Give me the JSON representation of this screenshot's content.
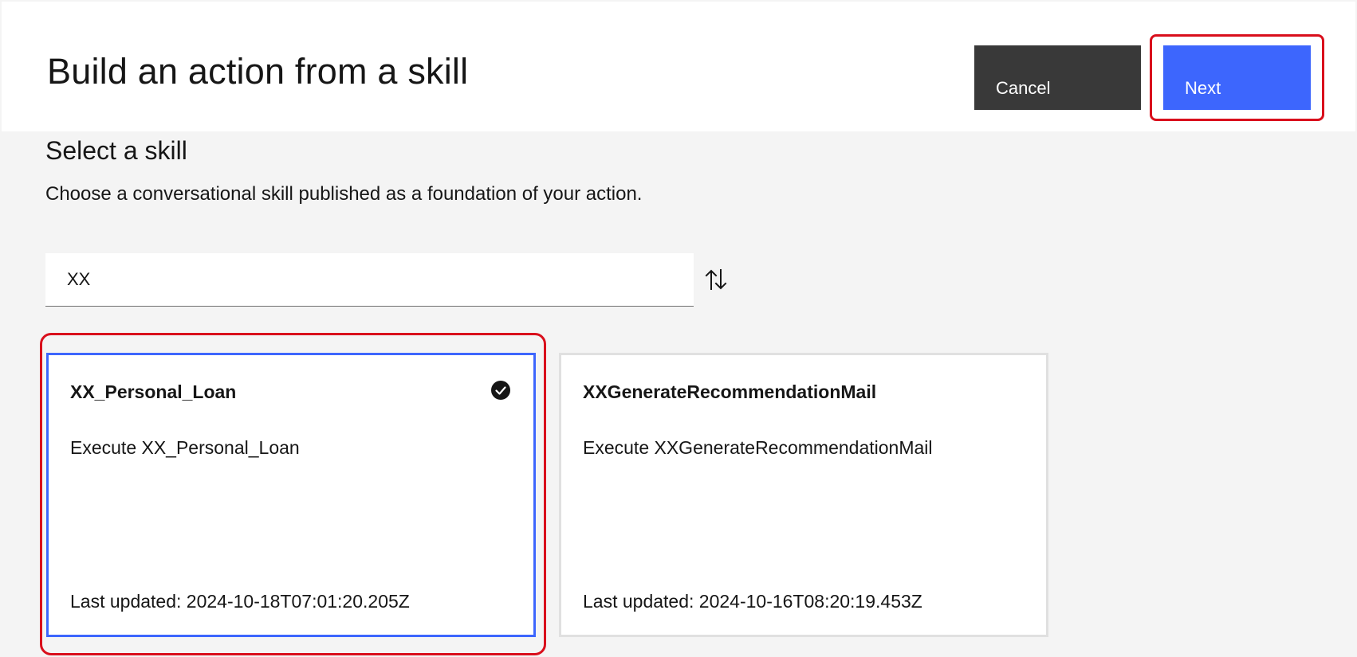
{
  "header": {
    "title": "Build an action from a skill",
    "cancel_label": "Cancel",
    "next_label": "Next"
  },
  "section": {
    "title": "Select a skill",
    "description": "Choose a conversational skill published as a foundation of your action."
  },
  "search": {
    "value": "XX",
    "sort_icon": "sort-arrows-icon"
  },
  "cards": [
    {
      "title": "XX_Personal_Loan",
      "description": "Execute XX_Personal_Loan",
      "updated": "Last updated: 2024-10-18T07:01:20.205Z",
      "selected": true
    },
    {
      "title": "XXGenerateRecommendationMail",
      "description": "Execute XXGenerateRecommendationMail",
      "updated": "Last updated: 2024-10-16T08:20:19.453Z",
      "selected": false
    }
  ],
  "colors": {
    "primary": "#3d66fd",
    "secondary_button": "#393939",
    "highlight": "#d90f1c",
    "background": "#f4f4f4"
  }
}
